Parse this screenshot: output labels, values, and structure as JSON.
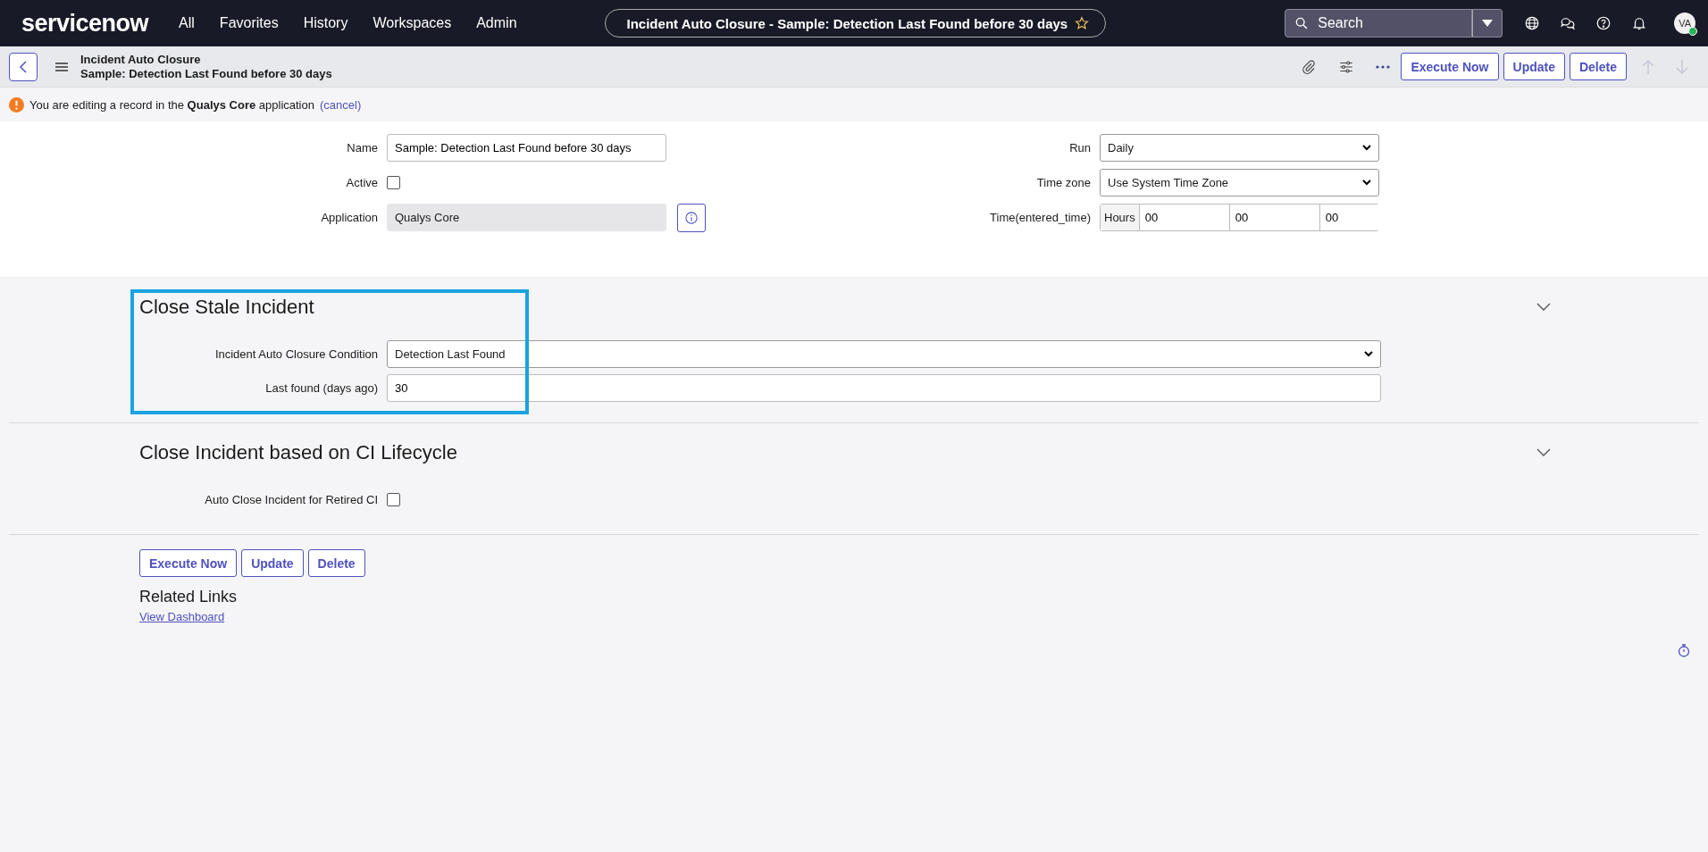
{
  "topbar": {
    "logo": "servicenow",
    "nav": [
      "All",
      "Favorites",
      "History",
      "Workspaces",
      "Admin"
    ],
    "record_pill": "Incident Auto Closure - Sample: Detection Last Found before 30 days",
    "search": {
      "placeholder": "Search"
    },
    "avatar": "VA"
  },
  "header": {
    "table": "Incident Auto Closure",
    "record": "Sample: Detection Last Found before 30 days",
    "buttons": [
      "Execute Now",
      "Update",
      "Delete"
    ]
  },
  "notice": {
    "text": "You are editing a record in the **Qualys Core** application",
    "link": "(cancel)"
  },
  "form": {
    "name": {
      "label": "Name",
      "value": "Sample: Detection Last Found before 30 days"
    },
    "active": {
      "label": "Active",
      "checked": false
    },
    "application": {
      "label": "Application",
      "value": "Qualys Core"
    },
    "run": {
      "label": "Run",
      "value": "Daily"
    },
    "time_zone": {
      "label": "Time zone",
      "value": "Use System Time Zone"
    },
    "time": {
      "label": "Time(entered_time)",
      "unit": "Hours",
      "values": [
        "00",
        "00",
        "00"
      ]
    }
  },
  "sections": [
    {
      "title": "Close Stale Incident",
      "highlighted": true,
      "fields": [
        {
          "kind": "select",
          "label": "Incident Auto Closure Condition",
          "value": "Detection Last Found"
        },
        {
          "kind": "text",
          "label": "Last found (days ago)",
          "value": "30"
        }
      ]
    },
    {
      "title": "Close Incident based on CI Lifecycle",
      "highlighted": false,
      "fields": [
        {
          "kind": "checkbox",
          "label": "Auto Close Incident for Retired CI",
          "checked": false
        }
      ]
    }
  ],
  "bottom_buttons": [
    "Execute Now",
    "Update",
    "Delete"
  ],
  "related_links": {
    "title": "Related Links",
    "links": [
      "View Dashboard"
    ]
  }
}
